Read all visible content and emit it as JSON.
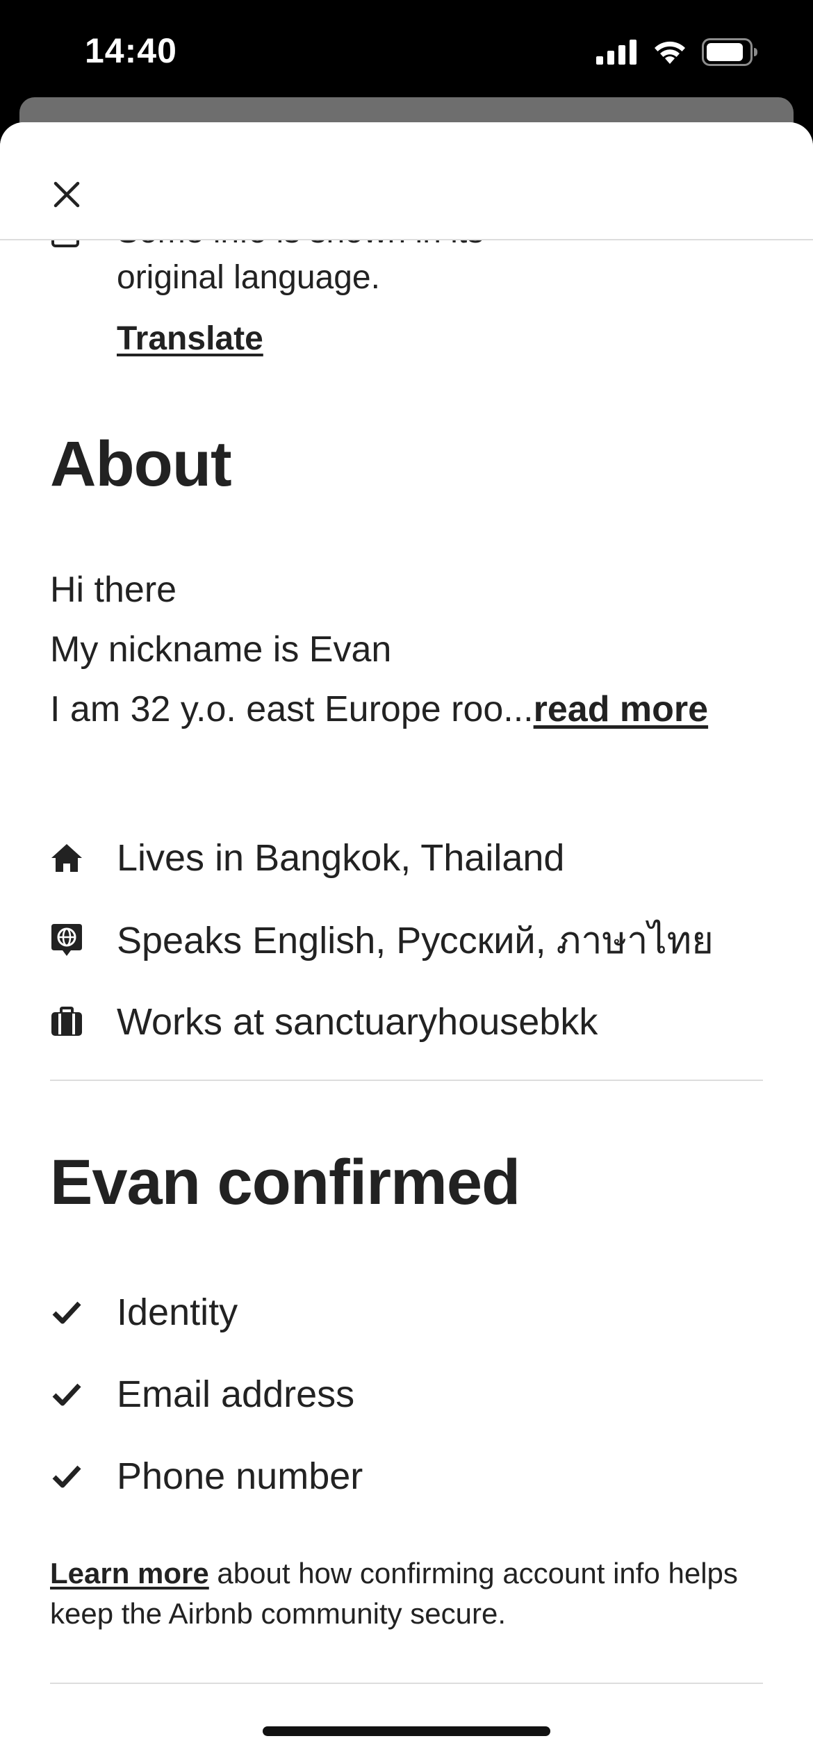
{
  "status_bar": {
    "time": "14:40",
    "icons": [
      "signal-icon",
      "wifi-icon",
      "battery-icon"
    ]
  },
  "header": {
    "close_icon": "close-icon"
  },
  "translation_notice": {
    "clipped_text": "Some info is shown in its",
    "text": "original language.",
    "link": "Translate"
  },
  "about": {
    "heading": "About",
    "line1": "Hi there",
    "line2": "My nickname is Evan",
    "line3": "I am 32 y.o. east Europe roo...",
    "read_more": "read more"
  },
  "facts": [
    {
      "icon": "home-icon",
      "text": "Lives in Bangkok, Thailand"
    },
    {
      "icon": "language-icon",
      "text": "Speaks English, Русский, ภาษาไทย"
    },
    {
      "icon": "briefcase-icon",
      "text": "Works at sanctuaryhousebkk"
    }
  ],
  "confirmed": {
    "heading": "Evan confirmed",
    "items": [
      "Identity",
      "Email address",
      "Phone number"
    ],
    "learn_more_link": "Learn more",
    "learn_more_text": " about how confirming account info helps keep the Airbnb community secure."
  },
  "colors": {
    "text": "#222222",
    "divider": "#dddddd",
    "status_bar_bg": "#000000"
  }
}
